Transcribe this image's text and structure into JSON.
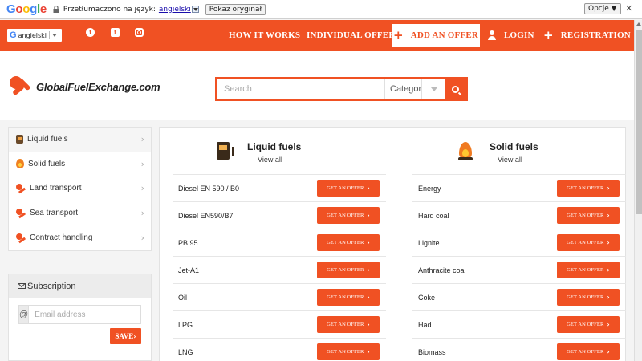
{
  "translate_bar": {
    "google_logo": [
      "G",
      "o",
      "o",
      "g",
      "l",
      "e"
    ],
    "message": "Przetłumaczono na język:",
    "language": "angielski",
    "show_original": "Pokaż oryginał",
    "options": "Opcje ▼",
    "close": "✕"
  },
  "header": {
    "language_selector": "angielski",
    "nav": {
      "how_it_works": "HOW IT WORKS",
      "individual_offer": "INDIVIDUAL OFFER",
      "add_offer": "ADD AN OFFER",
      "login": "LOGIN",
      "registration": "REGISTRATION"
    },
    "social_icons": [
      "facebook-icon",
      "twitter-icon",
      "instagram-icon"
    ]
  },
  "brand": {
    "logo_text": "GlobalFuelExchange.com"
  },
  "search": {
    "placeholder": "Search",
    "category_label": "Categor"
  },
  "sidebar": {
    "items": [
      {
        "label": "Liquid fuels",
        "icon": "fuel-pump-icon"
      },
      {
        "label": "Solid fuels",
        "icon": "flame-icon"
      },
      {
        "label": "Land transport",
        "icon": "brand-logo-icon"
      },
      {
        "label": "Sea transport",
        "icon": "brand-logo-icon"
      },
      {
        "label": "Contract handling",
        "icon": "brand-logo-icon"
      }
    ]
  },
  "subscription": {
    "title": "Subscription",
    "at_symbol": "@",
    "email_placeholder": "Email address",
    "save_label": "SAVE"
  },
  "categories": {
    "liquid": {
      "title": "Liquid fuels",
      "view_all": "View all",
      "items": [
        "Diesel EN 590 / B0",
        "Diesel EN590/B7",
        "PB 95",
        "Jet-A1",
        "Oil",
        "LPG",
        "LNG"
      ]
    },
    "solid": {
      "title": "Solid fuels",
      "view_all": "View all",
      "items": [
        "Energy",
        "Hard coal",
        "Lignite",
        "Anthracite coal",
        "Coke",
        "Had",
        "Biomass"
      ]
    },
    "offer_button_label": "GET AN OFFER"
  },
  "colors": {
    "brand_orange": "#f05123"
  }
}
